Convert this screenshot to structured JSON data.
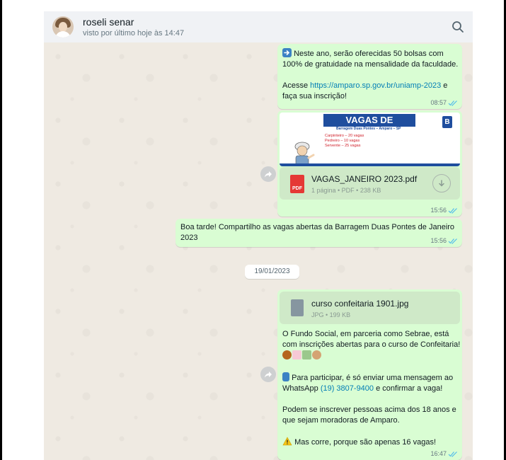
{
  "header": {
    "contact_name": "roseli senar",
    "status": "visto por último hoje às 14:47"
  },
  "icons": {
    "search": "search-icon",
    "forward": "forward-icon",
    "read_receipt": "double-check-icon",
    "download": "download-icon",
    "arrow_emoji": "arrow-right-emoji-icon",
    "phone_emoji": "mobile-phone-emoji-icon",
    "warning_emoji": "warning-emoji-icon",
    "food_emojis": "cake-cookie-emoji-icons"
  },
  "colors": {
    "outgoing_bubble": "#d9fdd3",
    "chat_background": "#efeae2",
    "header_background": "#f0f2f5",
    "link": "#027eb5",
    "read_tick": "#53bdeb",
    "pdf_red": "#e53935"
  },
  "messages": {
    "msg1": {
      "line1": "Neste ano, serão oferecidas 50 bolsas com",
      "line2": "100% de gratuidade na mensalidade da faculdade.",
      "line3_prefix": "Acesse ",
      "link": "https://amparo.sp.gov.br/uniamp-2023",
      "line3_suffix": " e",
      "line4": "faça sua inscrição!",
      "time": "08:57"
    },
    "msg2": {
      "preview_title": "VAGAS DE EMPREGO:",
      "preview_subtitle": "Barragem Duas Pontes – Amparo – SP",
      "preview_line1": "Carpinteiro – 20 vagas",
      "preview_line2": "Pedreiro – 10 vagas",
      "preview_line3": "Servente – 25 vagas",
      "preview_logo": "B",
      "file_name": "VAGAS_JANEIRO 2023.pdf",
      "file_info": "1 página • PDF • 238 KB",
      "file_type_label": "PDF",
      "time": "15:56"
    },
    "msg3": {
      "line1": "Boa tarde! Compartilho as vagas abertas da Barragem Duas Pontes de Janeiro",
      "line2": "2023",
      "time": "15:56"
    },
    "date_separator": "19/01/2023",
    "msg4": {
      "file_name": "curso confeitaria 1901.jpg",
      "file_info": "JPG • 199 KB",
      "p1_line1": "O Fundo Social, em parceria como Sebrae, está",
      "p1_line2": "com inscrições abertas para o curso de Confeitaria!",
      "p2_line1": "Para participar, é só enviar uma mensagem ao",
      "p2_line2_prefix": "WhatsApp ",
      "phone": "(19) 3807-9400",
      "p2_line2_suffix": " e confirmar a vaga!",
      "p3_line1": "Podem se inscrever pessoas acima dos 18 anos e",
      "p3_line2": "que sejam moradoras de Amparo.",
      "p4": "Mas corre, porque são apenas 16 vagas!",
      "time": "16:47"
    }
  }
}
